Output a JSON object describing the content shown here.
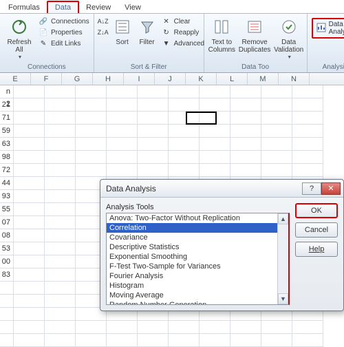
{
  "tabs": {
    "formulas": "Formulas",
    "data": "Data",
    "review": "Review",
    "view": "View"
  },
  "ribbon": {
    "connections": {
      "refresh": "Refresh\nAll",
      "connections": "Connections",
      "properties": "Properties",
      "editlinks": "Edit Links",
      "label": "Connections"
    },
    "sort": {
      "sort": "Sort",
      "filter": "Filter",
      "clear": "Clear",
      "reapply": "Reapply",
      "advanced": "Advanced",
      "label": "Sort & Filter"
    },
    "datatools": {
      "texttocol": "Text to\nColumns",
      "remdup": "Remove\nDuplicates",
      "validation": "Data\nValidation",
      "label": "Data Too"
    },
    "analysis": {
      "dataanalysis": "Data Analysis",
      "label": "Analysis"
    }
  },
  "columns": [
    "E",
    "F",
    "G",
    "H",
    "I",
    "J",
    "K",
    "L",
    "M",
    "N"
  ],
  "dcol_label": "n 2",
  "dcol": [
    "21",
    "71",
    "59",
    "63",
    "98",
    "72",
    "44",
    "93",
    "55",
    "07",
    "08",
    "53",
    "00",
    "83"
  ],
  "dialog": {
    "title": "Data Analysis",
    "toolslabel": "Analysis Tools",
    "items": [
      "Anova: Two-Factor Without Replication",
      "Correlation",
      "Covariance",
      "Descriptive Statistics",
      "Exponential Smoothing",
      "F-Test Two-Sample for Variances",
      "Fourier Analysis",
      "Histogram",
      "Moving Average",
      "Random Number Generation"
    ],
    "ok": "OK",
    "cancel": "Cancel",
    "help": "Help"
  }
}
